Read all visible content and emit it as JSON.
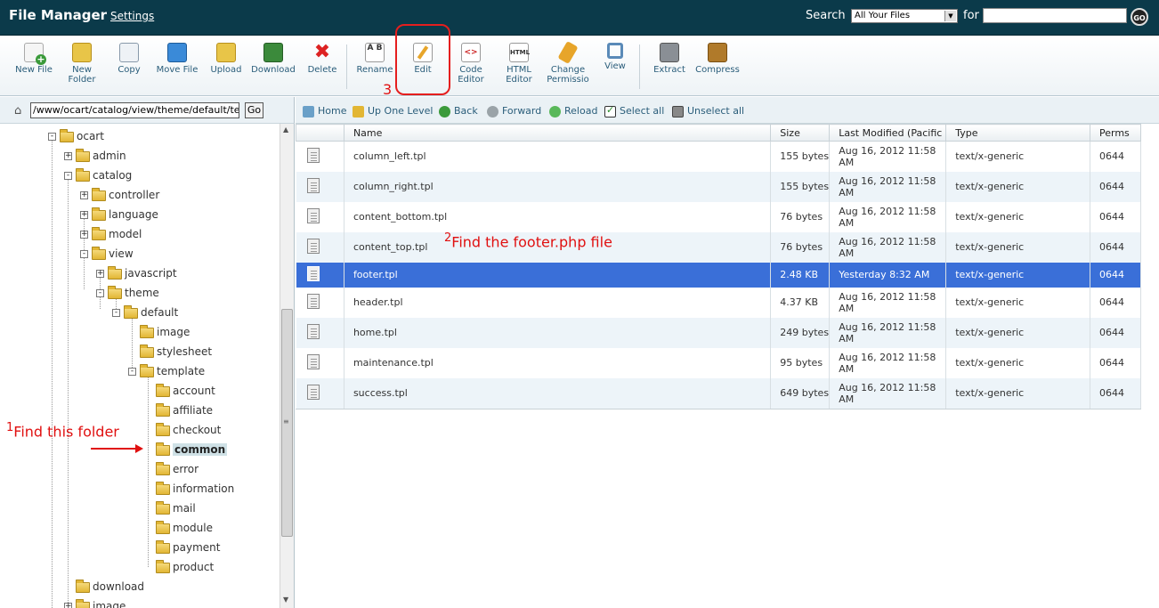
{
  "header": {
    "title": "File Manager",
    "settings": "Settings",
    "search_label": "Search",
    "search_scope": "All Your Files",
    "for_label": "for",
    "search_value": "",
    "go": "GO"
  },
  "toolbar": [
    {
      "label": "New File",
      "icon": "new-file-icon"
    },
    {
      "label": "New Folder",
      "icon": "new-folder-icon"
    },
    {
      "label": "Copy",
      "icon": "copy-icon"
    },
    {
      "label": "Move File",
      "icon": "move-file-icon"
    },
    {
      "label": "Upload",
      "icon": "upload-icon"
    },
    {
      "label": "Download",
      "icon": "download-icon"
    },
    {
      "label": "Delete",
      "icon": "delete-icon"
    },
    {
      "label": "Rename",
      "icon": "rename-icon"
    },
    {
      "label": "Edit",
      "icon": "edit-icon"
    },
    {
      "label": "Code Editor",
      "icon": "code-editor-icon"
    },
    {
      "label": "HTML Editor",
      "icon": "html-editor-icon"
    },
    {
      "label": "Change Permissio",
      "icon": "permissions-key-icon"
    },
    {
      "label": "View",
      "icon": "view-magnifier-icon"
    },
    {
      "label": "Extract",
      "icon": "extract-icon"
    },
    {
      "label": "Compress",
      "icon": "compress-icon"
    }
  ],
  "path": {
    "value": "/www/ocart/catalog/view/theme/default/template/common",
    "go": "Go"
  },
  "nav": {
    "home": "Home",
    "up": "Up One Level",
    "back": "Back",
    "forward": "Forward",
    "reload": "Reload",
    "select_all": "Select all",
    "unselect_all": "Unselect all"
  },
  "tree": [
    {
      "label": "ocart",
      "expander": "-"
    },
    {
      "label": "admin",
      "expander": "+"
    },
    {
      "label": "catalog",
      "expander": "-"
    },
    {
      "label": "controller",
      "expander": "+"
    },
    {
      "label": "language",
      "expander": "+"
    },
    {
      "label": "model",
      "expander": "+"
    },
    {
      "label": "view",
      "expander": "-"
    },
    {
      "label": "javascript",
      "expander": "+"
    },
    {
      "label": "theme",
      "expander": "-"
    },
    {
      "label": "default",
      "expander": "-"
    },
    {
      "label": "image",
      "expander": ""
    },
    {
      "label": "stylesheet",
      "expander": ""
    },
    {
      "label": "template",
      "expander": "-"
    },
    {
      "label": "account",
      "expander": ""
    },
    {
      "label": "affiliate",
      "expander": ""
    },
    {
      "label": "checkout",
      "expander": ""
    },
    {
      "label": "common",
      "expander": "",
      "selected": true
    },
    {
      "label": "error",
      "expander": ""
    },
    {
      "label": "information",
      "expander": ""
    },
    {
      "label": "mail",
      "expander": ""
    },
    {
      "label": "module",
      "expander": ""
    },
    {
      "label": "payment",
      "expander": ""
    },
    {
      "label": "product",
      "expander": ""
    },
    {
      "label": "download",
      "expander": ""
    },
    {
      "label": "image",
      "expander": "+"
    }
  ],
  "table": {
    "columns": [
      "",
      "Name",
      "Size",
      "Last Modified (Pacific Daylight Time)",
      "Type",
      "Perms"
    ],
    "rows": [
      {
        "name": "column_left.tpl",
        "size": "155 bytes",
        "modified": "Aug 16, 2012 11:58 AM",
        "type": "text/x-generic",
        "perms": "0644"
      },
      {
        "name": "column_right.tpl",
        "size": "155 bytes",
        "modified": "Aug 16, 2012 11:58 AM",
        "type": "text/x-generic",
        "perms": "0644"
      },
      {
        "name": "content_bottom.tpl",
        "size": "76 bytes",
        "modified": "Aug 16, 2012 11:58 AM",
        "type": "text/x-generic",
        "perms": "0644"
      },
      {
        "name": "content_top.tpl",
        "size": "76 bytes",
        "modified": "Aug 16, 2012 11:58 AM",
        "type": "text/x-generic",
        "perms": "0644"
      },
      {
        "name": "footer.tpl",
        "size": "2.48 KB",
        "modified": "Yesterday 8:32 AM",
        "type": "text/x-generic",
        "perms": "0644",
        "selected": true
      },
      {
        "name": "header.tpl",
        "size": "4.37 KB",
        "modified": "Aug 16, 2012 11:58 AM",
        "type": "text/x-generic",
        "perms": "0644"
      },
      {
        "name": "home.tpl",
        "size": "249 bytes",
        "modified": "Aug 16, 2012 11:58 AM",
        "type": "text/x-generic",
        "perms": "0644"
      },
      {
        "name": "maintenance.tpl",
        "size": "95 bytes",
        "modified": "Aug 16, 2012 11:58 AM",
        "type": "text/x-generic",
        "perms": "0644"
      },
      {
        "name": "success.tpl",
        "size": "649 bytes",
        "modified": "Aug 16, 2012 11:58 AM",
        "type": "text/x-generic",
        "perms": "0644"
      }
    ]
  },
  "annotations": {
    "step1_num": "1",
    "step1_text": "Find this folder",
    "step2_num": "2",
    "step2_text": "Find the footer.php file",
    "step3_num": "3"
  },
  "colors": {
    "header_bg": "#0b3a4a",
    "selected_row": "#3a6fd8",
    "annotation": "#e01010"
  }
}
